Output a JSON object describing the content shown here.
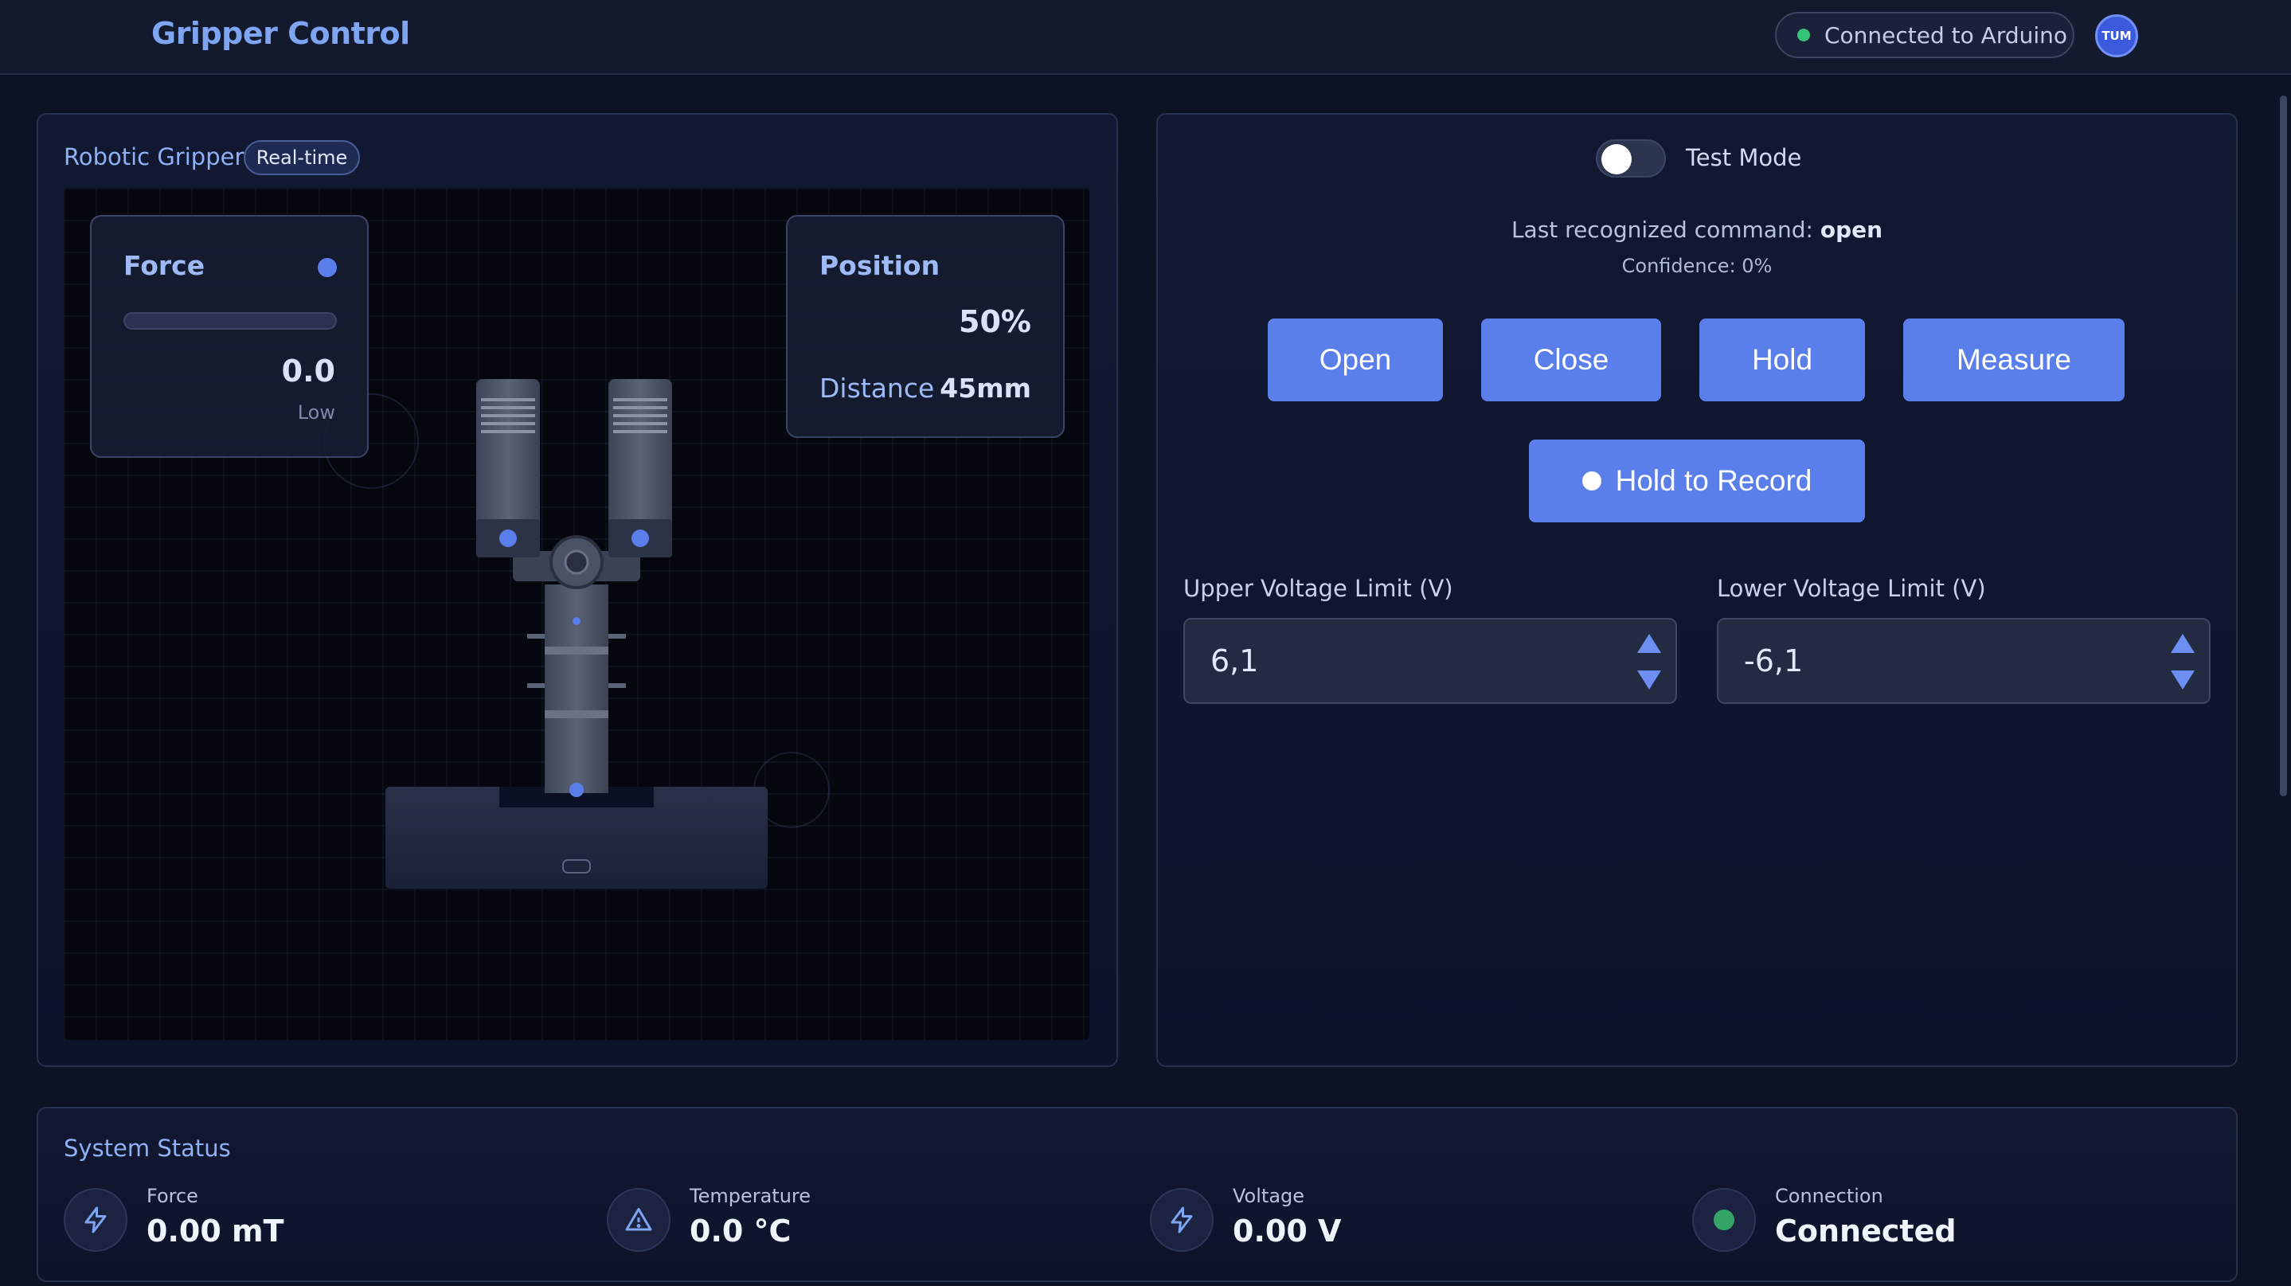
{
  "header": {
    "title": "Gripper Control",
    "connection_status": "Connected to Arduino",
    "avatar_text": "TUM"
  },
  "gripper_panel": {
    "title": "Robotic Gripper",
    "badge": "Real-time",
    "force": {
      "title": "Force",
      "value": "0.0",
      "level": "Low",
      "bar_fraction": 0
    },
    "position": {
      "title": "Position",
      "percent": "50%",
      "distance_label": "Distance",
      "distance_value": "45mm"
    }
  },
  "control_panel": {
    "test_mode_label": "Test Mode",
    "test_mode_on": false,
    "last_command_prefix": "Last recognized command:",
    "last_command": "open",
    "confidence": "Confidence: 0%",
    "buttons": {
      "open": "Open",
      "close": "Close",
      "hold": "Hold",
      "measure": "Measure",
      "record": "Hold to Record"
    },
    "upper_voltage": {
      "label": "Upper Voltage Limit (V)",
      "value": "6,1"
    },
    "lower_voltage": {
      "label": "Lower Voltage Limit (V)",
      "value": "-6,1"
    }
  },
  "system_status": {
    "title": "System Status",
    "items": [
      {
        "label": "Force",
        "value": "0.00 mT",
        "icon": "lightning-icon"
      },
      {
        "label": "Temperature",
        "value": "0.0 °C",
        "icon": "warning-triangle-icon"
      },
      {
        "label": "Voltage",
        "value": "0.00 V",
        "icon": "lightning-icon"
      },
      {
        "label": "Connection",
        "value": "Connected",
        "icon": "status-dot-icon"
      }
    ]
  },
  "colors": {
    "accent": "#5b7fea",
    "background": "#0d1225",
    "connected": "#36c277"
  }
}
